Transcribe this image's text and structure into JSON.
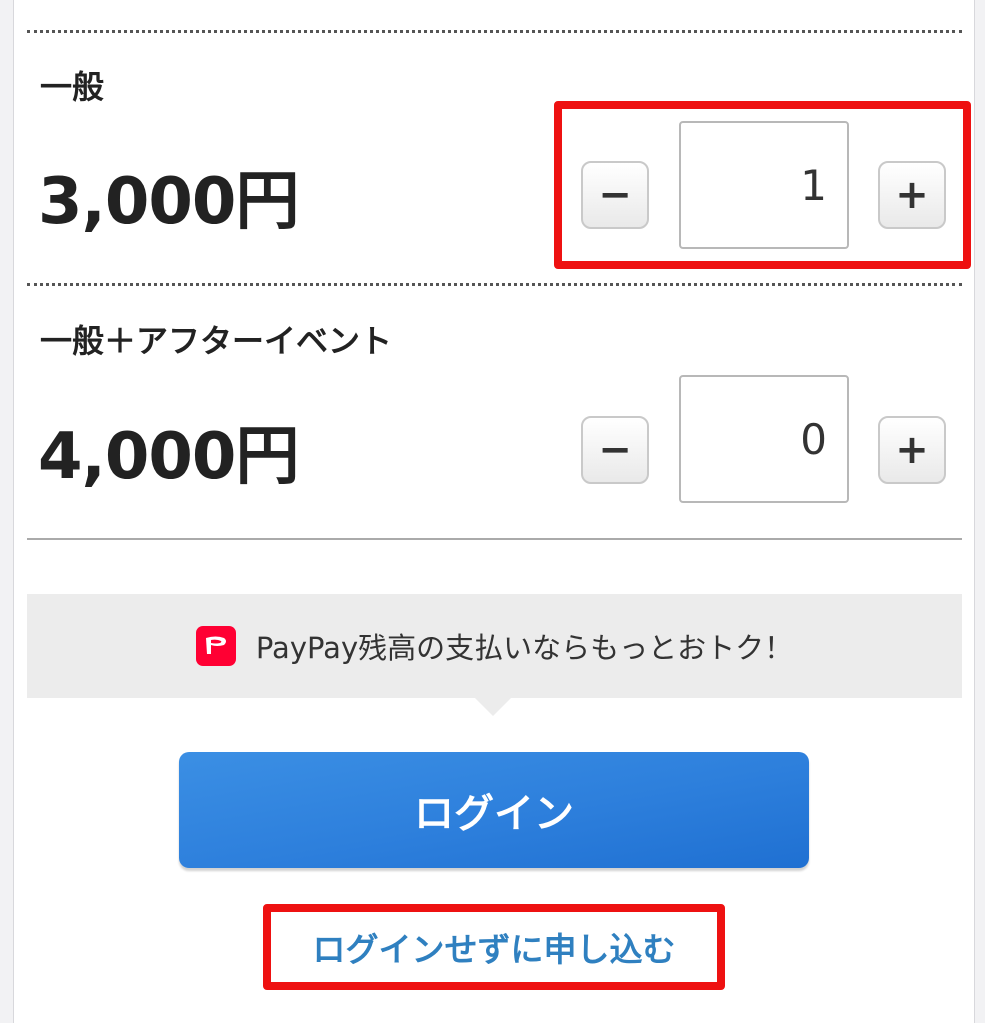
{
  "tickets": [
    {
      "name": "一般",
      "price": "3,000円",
      "quantity": "1",
      "minus": "−",
      "plus": "+"
    },
    {
      "name": "一般＋アフターイベント",
      "price": "4,000円",
      "quantity": "0",
      "minus": "−",
      "plus": "+"
    }
  ],
  "promo": {
    "icon": "paypay-logo-icon",
    "text": "PayPay残高の支払いならもっとおトク！"
  },
  "login_button": "ログイン",
  "guest_link": "ログインせずに申し込む",
  "colors": {
    "highlight": "#ee1111",
    "login_button": "#2d7fdc",
    "link": "#2f80c0",
    "paypay": "#ff0033"
  }
}
